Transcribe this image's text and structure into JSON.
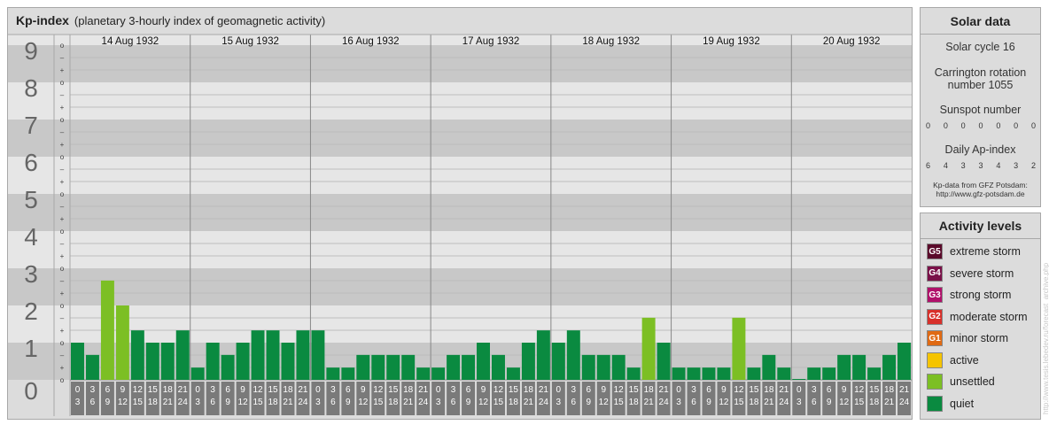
{
  "header": {
    "title": "Kp-index",
    "subtitle": "(planetary 3-hourly index of geomagnetic activity)"
  },
  "chart_data": {
    "type": "bar",
    "title": "Kp-index",
    "subtitle": "(planetary 3-hourly index of geomagnetic activity)",
    "days": [
      "14 Aug 1932",
      "15 Aug 1932",
      "16 Aug 1932",
      "17 Aug 1932",
      "18 Aug 1932",
      "19 Aug 1932",
      "20 Aug 1932"
    ],
    "hour_start_labels": [
      "0",
      "3",
      "6",
      "9",
      "12",
      "15",
      "18",
      "21"
    ],
    "hour_end_labels": [
      "3",
      "6",
      "9",
      "12",
      "15",
      "18",
      "21",
      "24"
    ],
    "ylim": [
      0,
      9
    ],
    "y_major_labels": [
      "0",
      "1",
      "2",
      "3",
      "4",
      "5",
      "6",
      "7",
      "8",
      "9"
    ],
    "y_minor_labels": [
      "+",
      "–",
      "o"
    ],
    "values": [
      [
        1.0,
        0.67,
        2.67,
        2.0,
        1.33,
        1.0,
        1.0,
        1.33
      ],
      [
        0.33,
        1.0,
        0.67,
        1.0,
        1.33,
        1.33,
        1.0,
        1.33
      ],
      [
        1.33,
        0.33,
        0.33,
        0.67,
        0.67,
        0.67,
        0.67,
        0.33
      ],
      [
        0.33,
        0.67,
        0.67,
        1.0,
        0.67,
        0.33,
        1.0,
        1.33
      ],
      [
        1.0,
        1.33,
        0.67,
        0.67,
        0.67,
        0.33,
        1.67,
        1.0
      ],
      [
        0.33,
        0.33,
        0.33,
        0.33,
        1.67,
        0.33,
        0.67,
        0.33
      ],
      [
        0.0,
        0.33,
        0.33,
        0.67,
        0.67,
        0.33,
        0.67,
        1.0
      ]
    ]
  },
  "solar": {
    "title": "Solar data",
    "cycle": "Solar cycle 16",
    "carrington_line1": "Carrington rotation",
    "carrington_line2": "number 1055",
    "sunspot_label": "Sunspot number",
    "sunspot_values": [
      "0",
      "0",
      "0",
      "0",
      "0",
      "0",
      "0"
    ],
    "ap_label": "Daily Ap-index",
    "ap_values": [
      "6",
      "4",
      "3",
      "3",
      "4",
      "3",
      "2"
    ],
    "source_line1": "Kp-data from GFZ Potsdam:",
    "source_line2": "http://www.gfz-potsdam.de"
  },
  "levels": {
    "title": "Activity levels",
    "items": [
      {
        "badge": "G5",
        "label": "extreme storm",
        "color": "#5a0a2a"
      },
      {
        "badge": "G4",
        "label": "severe storm",
        "color": "#7a1048"
      },
      {
        "badge": "G3",
        "label": "strong storm",
        "color": "#b0106a"
      },
      {
        "badge": "G2",
        "label": "moderate storm",
        "color": "#d8302a"
      },
      {
        "badge": "G1",
        "label": "minor storm",
        "color": "#e06a14"
      },
      {
        "badge": "",
        "label": "active",
        "color": "#f5c400"
      },
      {
        "badge": "",
        "label": "unsettled",
        "color": "#7cbf24"
      },
      {
        "badge": "",
        "label": "quiet",
        "color": "#0a8a40"
      }
    ]
  },
  "watermark": "http://www.tesis.lebedev.ru/forecast_archive.php"
}
